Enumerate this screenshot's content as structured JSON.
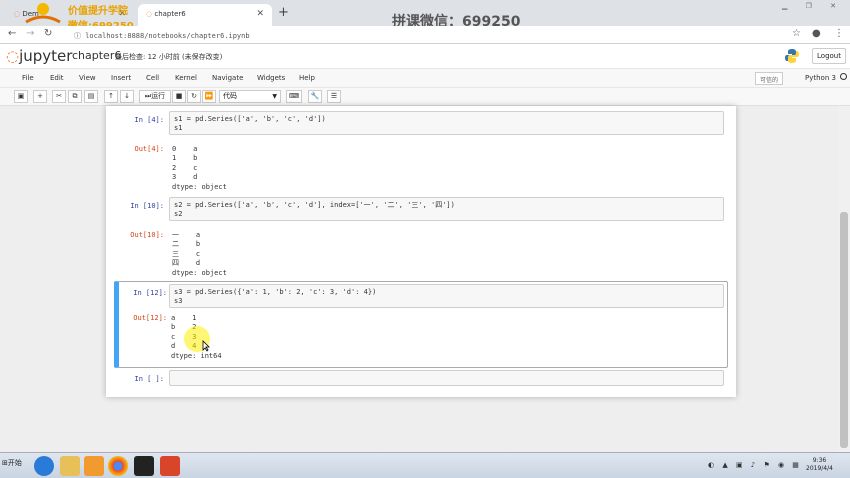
{
  "browser": {
    "tabs": [
      {
        "label": "Dem"
      },
      {
        "label": "chapter6"
      }
    ],
    "new_tab_symbol": "+",
    "url": "localhost:8888/notebooks/chapter6.ipynb"
  },
  "watermarks": {
    "logo_line1": "价值提升学院",
    "logo_line2": "微信:699250",
    "center": "拼课微信：699250"
  },
  "jupyter": {
    "logo_text": "jupyter",
    "notebook_name": "chapter6",
    "checkpoint": "最后检查: 12 小时前 (未保存改变)",
    "logout_label": "Logout",
    "menus": [
      "File",
      "Edit",
      "View",
      "Insert",
      "Cell",
      "Kernel",
      "Navigate",
      "Widgets",
      "Help"
    ],
    "trusted_label": "可信的",
    "kernel_name": "Python 3",
    "run_label": "运行",
    "cell_type": "代码"
  },
  "cells": [
    {
      "in_prompt": "In  [4]:",
      "code": [
        "s1 = pd.Series(['a', 'b', 'c', 'd'])",
        "s1"
      ],
      "out_prompt": "Out[4]:",
      "output": [
        "0    a",
        "1    b",
        "2    c",
        "3    d",
        "dtype: object"
      ]
    },
    {
      "in_prompt": "In  [10]:",
      "code": [
        "s2 = pd.Series(['a', 'b', 'c', 'd'], index=['一', '二', '三', '四'])",
        "s2"
      ],
      "out_prompt": "Out[10]:",
      "output": [
        "一    a",
        "二    b",
        "三    c",
        "四    d",
        "dtype: object"
      ]
    },
    {
      "in_prompt": "In  [12]:",
      "code": [
        "s3 = pd.Series({'a': 1, 'b': 2, 'c': 3, 'd': 4})",
        "s3"
      ],
      "out_prompt": "Out[12]:",
      "output": [
        "a    1",
        "b    2",
        "c    3",
        "d    4",
        "dtype: int64"
      ]
    },
    {
      "in_prompt": "In  [ ]:",
      "code": [
        ""
      ]
    }
  ],
  "taskbar": {
    "start_label": "开始",
    "time": "9:36",
    "date": "2019/4/4"
  }
}
